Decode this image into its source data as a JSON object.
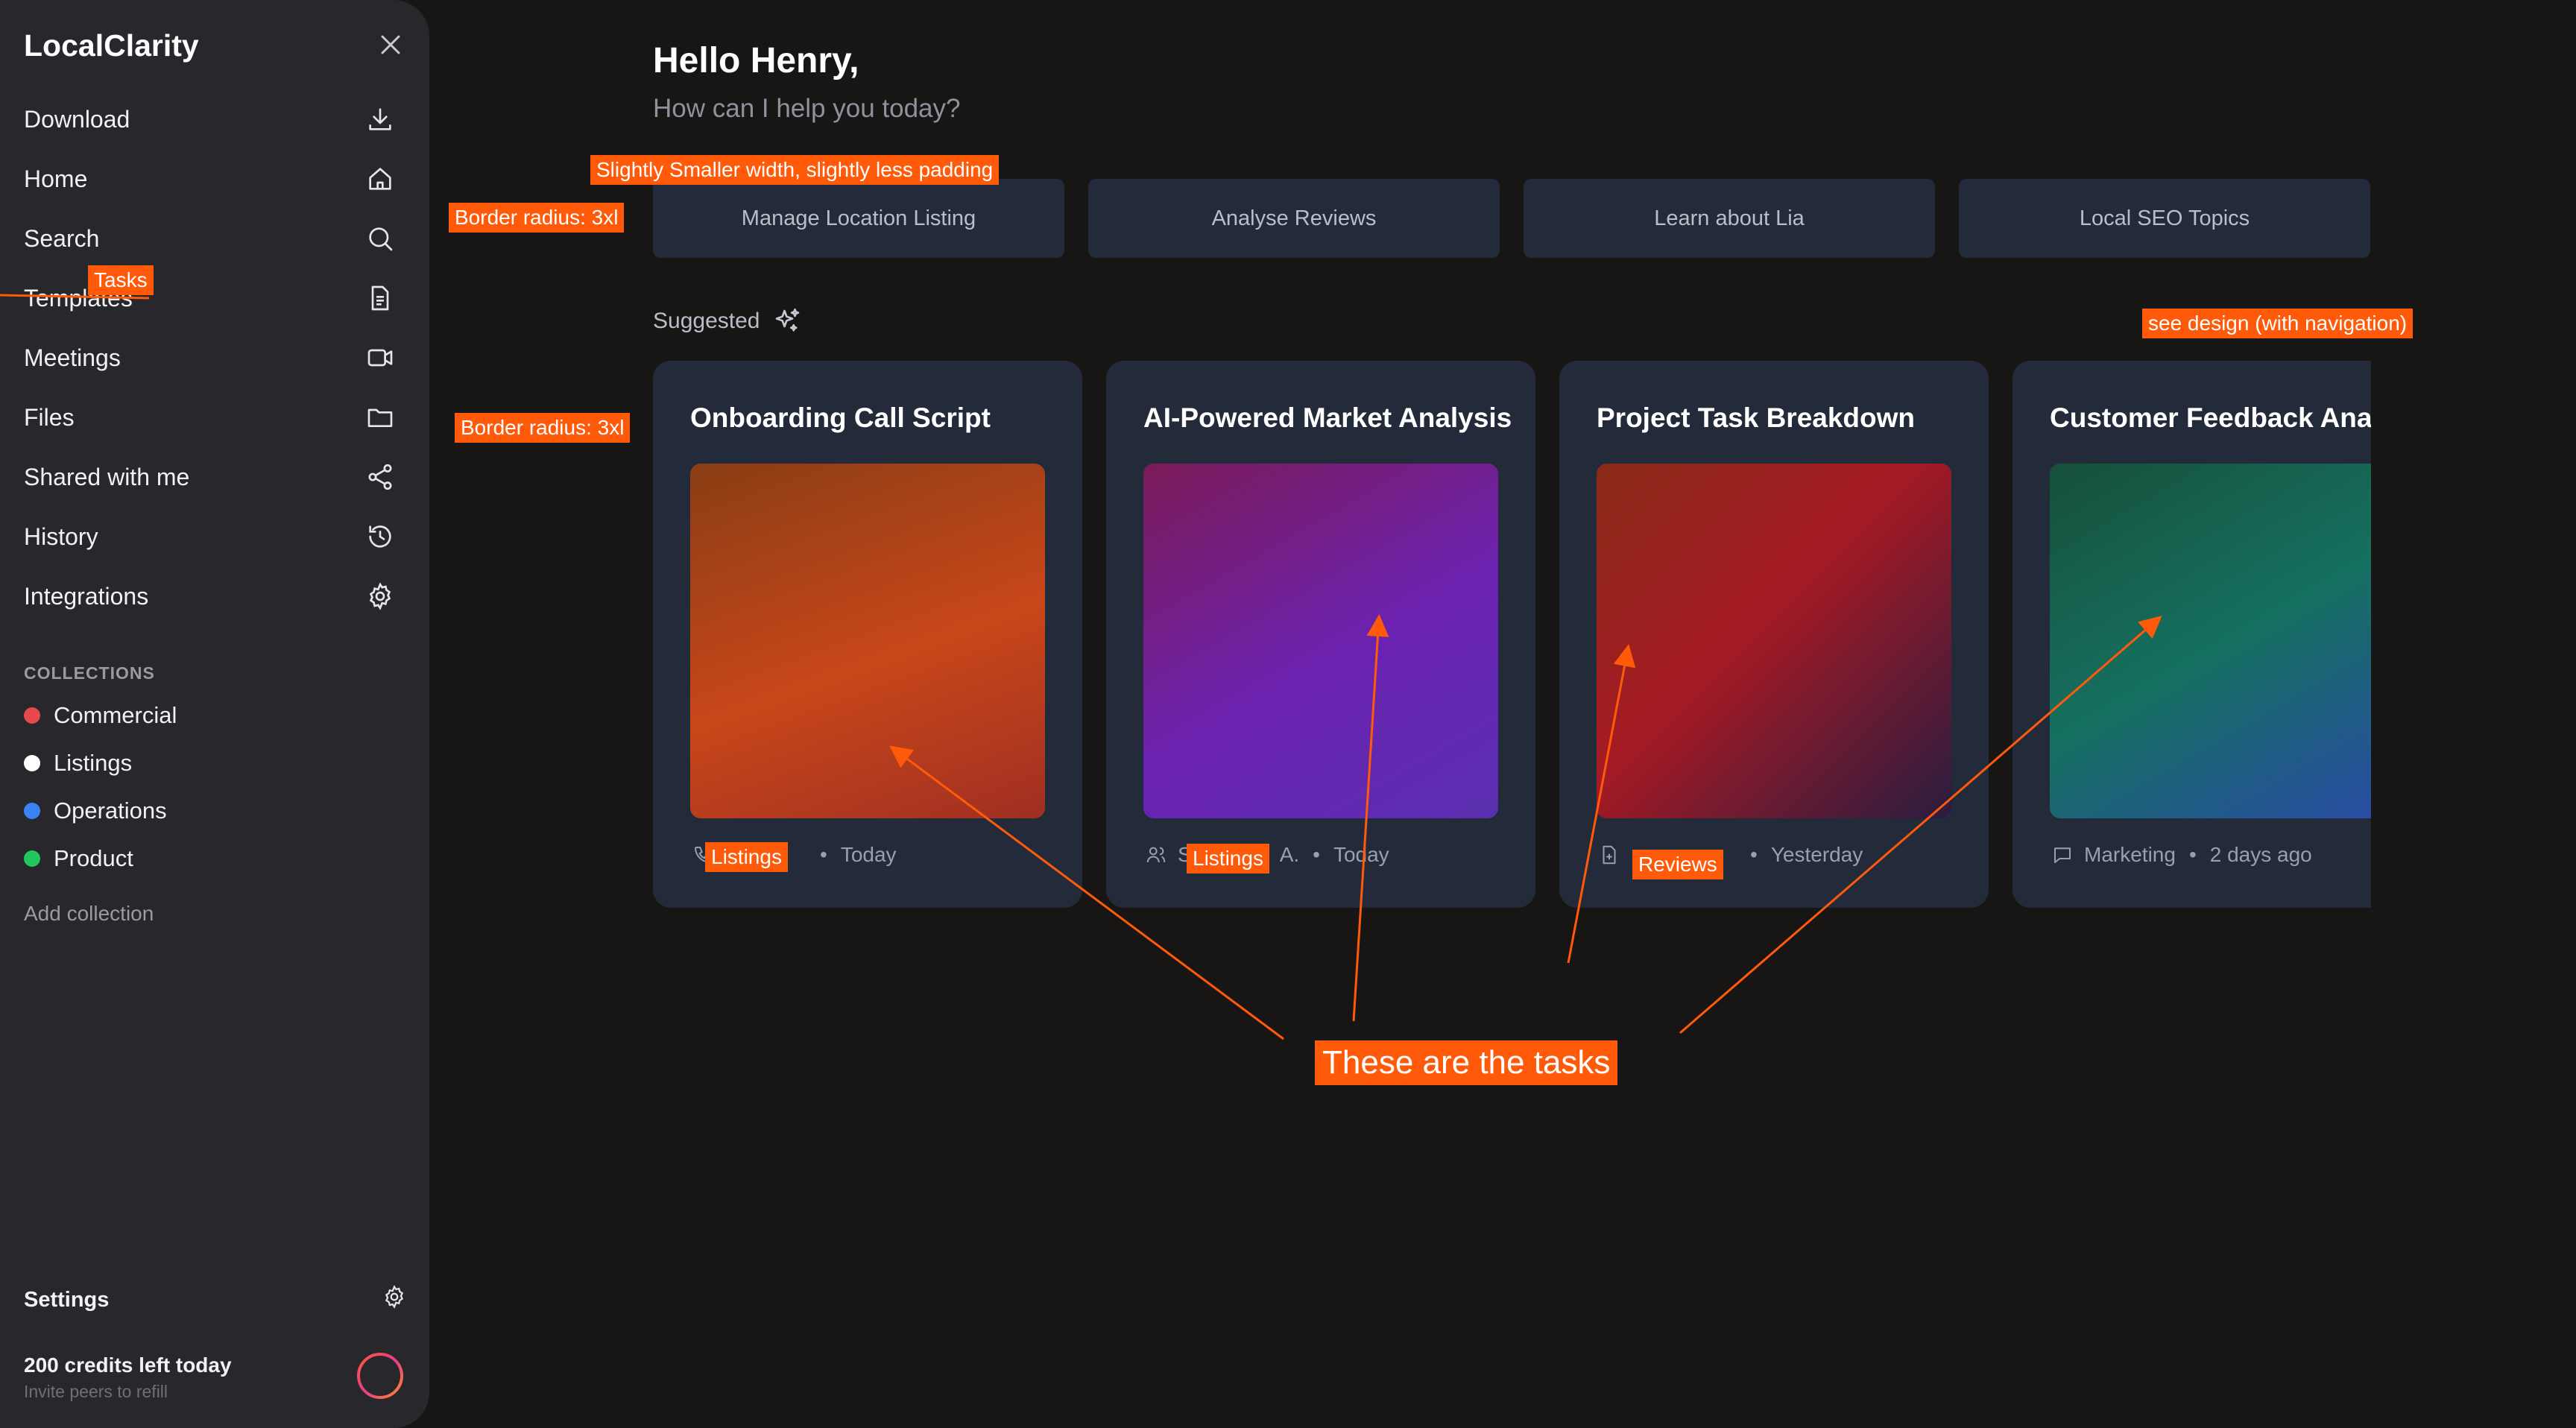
{
  "sidebar": {
    "brand": "LocalClarity",
    "close_icon": "close-icon",
    "nav": [
      {
        "label": "Download",
        "icon": "download-icon"
      },
      {
        "label": "Home",
        "icon": "home-icon"
      },
      {
        "label": "Search",
        "icon": "search-icon"
      },
      {
        "label": "Templates",
        "icon": "document-icon"
      },
      {
        "label": "Meetings",
        "icon": "video-icon"
      },
      {
        "label": "Files",
        "icon": "folder-icon"
      },
      {
        "label": "Shared with me",
        "icon": "share-icon"
      },
      {
        "label": "History",
        "icon": "history-icon"
      },
      {
        "label": "Integrations",
        "icon": "gear-icon"
      }
    ],
    "collections_title": "COLLECTIONS",
    "collections": [
      {
        "label": "Commercial",
        "color": "#e5484d"
      },
      {
        "label": "Listings",
        "color": "#ffffff"
      },
      {
        "label": "Operations",
        "color": "#3b82f6"
      },
      {
        "label": "Product",
        "color": "#22c55e"
      }
    ],
    "add_collection": "Add collection",
    "settings_label": "Settings",
    "credits_title": "200 credits left today",
    "credits_sub": "Invite peers to refill"
  },
  "main": {
    "greeting": "Hello Henry,",
    "sub_greeting": "How can I help you today?",
    "quick_actions": [
      "Manage Location Listing",
      "Analyse Reviews",
      "Learn about Lia",
      "Local SEO Topics"
    ],
    "suggested_label": "Suggested",
    "cards": [
      {
        "title": "Onboarding Call Script",
        "meta_icon": "phone-icon",
        "category": "",
        "date": "Today",
        "gradient": [
          "#8a3d14",
          "#c8471a",
          "#a02f22"
        ]
      },
      {
        "title": "AI-Powered Market Analysis",
        "meta_icon": "users-icon",
        "category": "S",
        "category_suffix": "A.",
        "date": "Today",
        "gradient": [
          "#7c1b58",
          "#6b22b0",
          "#5a2fb0"
        ]
      },
      {
        "title": "Project Task Breakdown",
        "meta_icon": "file-icon",
        "category": "",
        "date": "Yesterday",
        "gradient": [
          "#8a2a18",
          "#a51a24",
          "#2a1c40"
        ]
      },
      {
        "title": "Customer Feedback Analysis",
        "meta_icon": "chat-icon",
        "category": "Marketing",
        "date": "2 days ago",
        "gradient": [
          "#17503a",
          "#157060",
          "#2a4aa8"
        ]
      }
    ]
  },
  "annotations": {
    "tasks": "Tasks",
    "padding": "Slightly Smaller width, slightly less padding",
    "radius_buttons": "Border radius: 3xl",
    "radius_cards": "Border radius: 3xl",
    "see_design": "see design (with navigation)",
    "card1_tag": "Listings",
    "card2_tag": "Listings",
    "card3_tag": "Reviews",
    "tasks_callout": "These are the tasks",
    "color": "#ff5a0a"
  }
}
